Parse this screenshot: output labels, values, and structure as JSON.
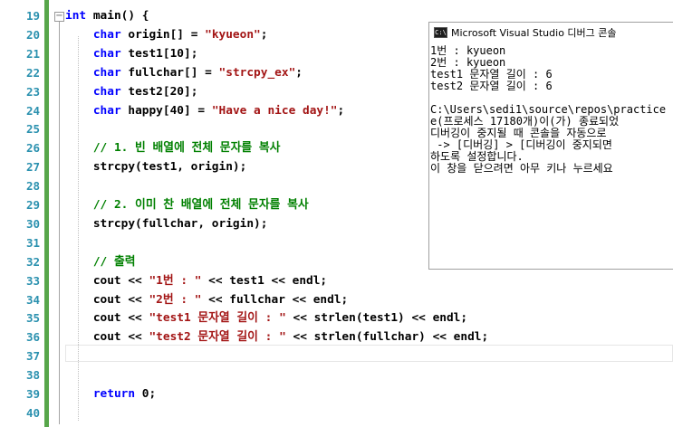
{
  "editor": {
    "line_numbers": [
      "19",
      "20",
      "21",
      "22",
      "23",
      "24",
      "25",
      "26",
      "27",
      "28",
      "29",
      "30",
      "31",
      "32",
      "33",
      "34",
      "35",
      "36",
      "37",
      "38",
      "39",
      "40"
    ],
    "fold_symbol": "−",
    "lines": [
      [
        {
          "t": "int",
          "c": "kw"
        },
        {
          "t": " main() {",
          "c": ""
        }
      ],
      [
        {
          "t": "    ",
          "c": ""
        },
        {
          "t": "char",
          "c": "kw"
        },
        {
          "t": " origin[] = ",
          "c": ""
        },
        {
          "t": "\"kyueon\"",
          "c": "str"
        },
        {
          "t": ";",
          "c": ""
        }
      ],
      [
        {
          "t": "    ",
          "c": ""
        },
        {
          "t": "char",
          "c": "kw"
        },
        {
          "t": " test1[10];",
          "c": ""
        }
      ],
      [
        {
          "t": "    ",
          "c": ""
        },
        {
          "t": "char",
          "c": "kw"
        },
        {
          "t": " fullchar[] = ",
          "c": ""
        },
        {
          "t": "\"strcpy_ex\"",
          "c": "str"
        },
        {
          "t": ";",
          "c": ""
        }
      ],
      [
        {
          "t": "    ",
          "c": ""
        },
        {
          "t": "char",
          "c": "kw"
        },
        {
          "t": " test2[20];",
          "c": ""
        }
      ],
      [
        {
          "t": "    ",
          "c": ""
        },
        {
          "t": "char",
          "c": "kw"
        },
        {
          "t": " happy[40] = ",
          "c": ""
        },
        {
          "t": "\"Have a nice day!\"",
          "c": "str"
        },
        {
          "t": ";",
          "c": ""
        }
      ],
      [],
      [
        {
          "t": "    ",
          "c": ""
        },
        {
          "t": "// 1. 빈 배열에 전체 문자를 복사",
          "c": "cmt"
        }
      ],
      [
        {
          "t": "    strcpy(test1, origin);",
          "c": ""
        }
      ],
      [],
      [
        {
          "t": "    ",
          "c": ""
        },
        {
          "t": "// 2. 이미 찬 배열에 전체 문자를 복사",
          "c": "cmt"
        }
      ],
      [
        {
          "t": "    strcpy(fullchar, origin);",
          "c": ""
        }
      ],
      [],
      [
        {
          "t": "    ",
          "c": ""
        },
        {
          "t": "// 출력",
          "c": "cmt"
        }
      ],
      [
        {
          "t": "    cout << ",
          "c": ""
        },
        {
          "t": "\"1번 : \"",
          "c": "str"
        },
        {
          "t": " << test1 << endl;",
          "c": ""
        }
      ],
      [
        {
          "t": "    cout << ",
          "c": ""
        },
        {
          "t": "\"2번 : \"",
          "c": "str"
        },
        {
          "t": " << fullchar << endl;",
          "c": ""
        }
      ],
      [
        {
          "t": "    cout << ",
          "c": ""
        },
        {
          "t": "\"test1 문자열 길이 : \"",
          "c": "str"
        },
        {
          "t": " << strlen(test1) << endl;",
          "c": ""
        }
      ],
      [
        {
          "t": "    cout << ",
          "c": ""
        },
        {
          "t": "\"test2 문자열 길이 : \"",
          "c": "str"
        },
        {
          "t": " << strlen(fullchar) << endl;",
          "c": ""
        }
      ],
      [],
      [],
      [
        {
          "t": "    ",
          "c": ""
        },
        {
          "t": "return",
          "c": "kw"
        },
        {
          "t": " 0;",
          "c": ""
        }
      ],
      []
    ]
  },
  "console": {
    "icon_text": "C:\\",
    "title": "Microsoft Visual Studio 디버그 콘솔",
    "output_lines": [
      "1번 : kyueon",
      "2번 : kyueon",
      "test1 문자열 길이 : 6",
      "test2 문자열 길이 : 6",
      "",
      "C:\\Users\\sedi1\\source\\repos\\practice",
      "e(프로세스 17180개)이(가) 종료되었",
      "디버깅이 중지될 때 콘솔을 자동으로",
      " -> [디버깅] > [디버깅이 중지되면",
      "하도록 설정합니다.",
      "이 창을 닫으려면 아무 키나 누르세요"
    ]
  },
  "colors": {
    "keyword": "#0000ff",
    "string": "#a31515",
    "comment": "#008000",
    "line_number": "#2b91af",
    "change_bar": "#57a64a"
  }
}
